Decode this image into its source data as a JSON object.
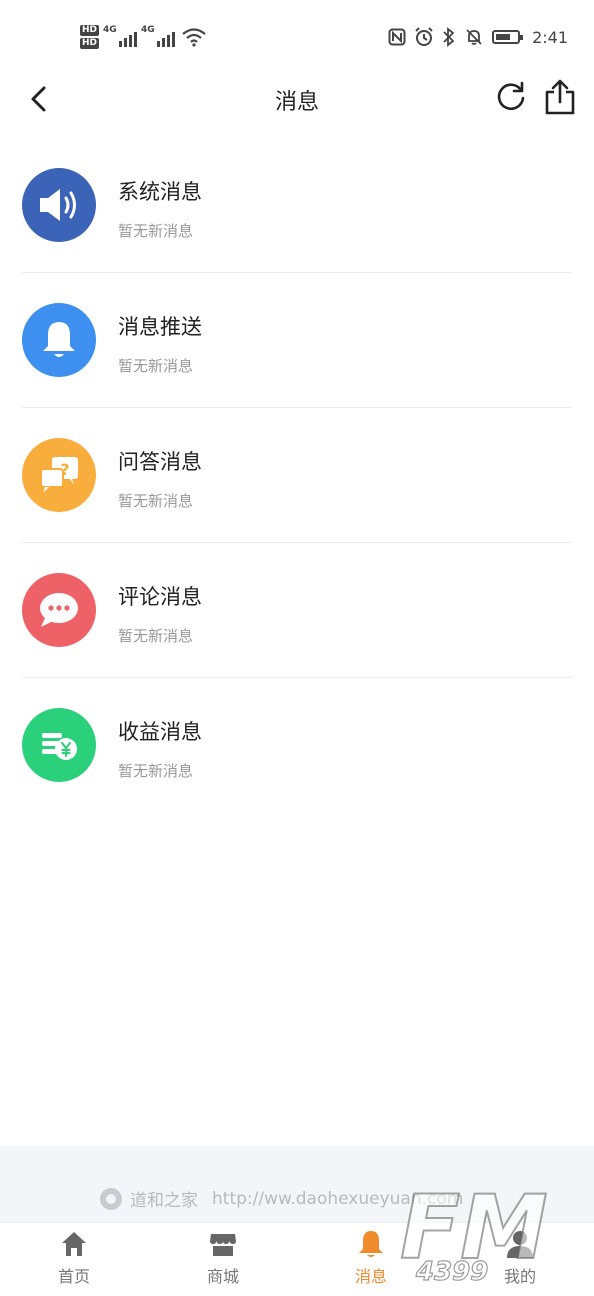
{
  "status_bar": {
    "hd1": "HD",
    "hd2": "HD",
    "net1": "4G",
    "net2": "4G",
    "time": "2:41"
  },
  "header": {
    "title": "消息"
  },
  "messages": [
    {
      "title": "系统消息",
      "subtitle": "暂无新消息",
      "icon": "speaker-icon",
      "color": "#3b63b8"
    },
    {
      "title": "消息推送",
      "subtitle": "暂无新消息",
      "icon": "bell-icon",
      "color": "#3d8ff0"
    },
    {
      "title": "问答消息",
      "subtitle": "暂无新消息",
      "icon": "qa-icon",
      "color": "#f8ad3d"
    },
    {
      "title": "评论消息",
      "subtitle": "暂无新消息",
      "icon": "comment-icon",
      "color": "#ee6166"
    },
    {
      "title": "收益消息",
      "subtitle": "暂无新消息",
      "icon": "coins-yen-icon",
      "color": "#2bd07a"
    }
  ],
  "footer": {
    "brand": "道和之家",
    "url": "http://ww.daohexueyuan.com"
  },
  "tabs": [
    {
      "label": "首页",
      "icon": "home-icon",
      "active": false
    },
    {
      "label": "商城",
      "icon": "store-icon",
      "active": false
    },
    {
      "label": "消息",
      "icon": "bell-icon",
      "active": true
    },
    {
      "label": "我的",
      "icon": "user-icon",
      "active": false
    }
  ],
  "colors": {
    "accent": "#f08b2c",
    "tab_inactive": "#777777"
  },
  "watermark": {
    "text_large": "FM",
    "text_small": "4399"
  }
}
